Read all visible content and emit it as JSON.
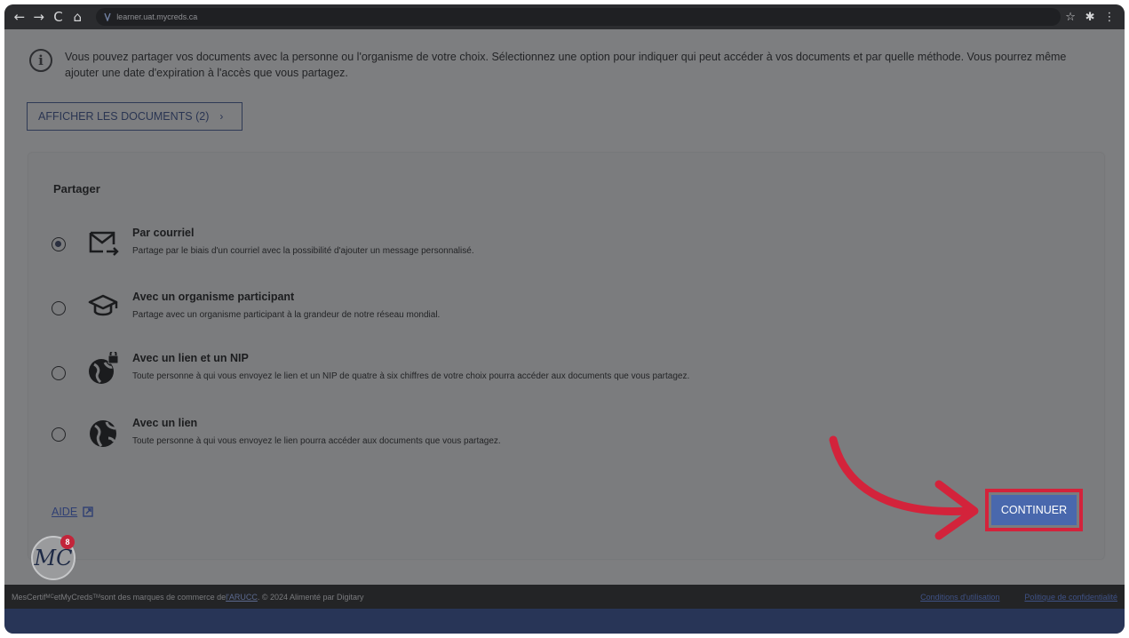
{
  "browser": {
    "url": "learner.uat.mycreds.ca",
    "back_glyph": "←",
    "forward_glyph": "→",
    "reload_glyph": "C",
    "home_glyph": "⌂",
    "star_glyph": "☆",
    "extension_glyph": "✱",
    "menu_glyph": "⋮"
  },
  "info": {
    "icon_glyph": "i",
    "text": "Vous pouvez partager vos documents avec la personne ou l'organisme de votre choix. Sélectionnez une option pour indiquer qui peut accéder à vos documents et par quelle méthode. Vous pourrez même ajouter une date d'expiration à l'accès que vous partagez."
  },
  "show_documents": {
    "label": "AFFICHER LES DOCUMENTS (2)",
    "chevron": "›"
  },
  "share": {
    "title": "Partager",
    "options": [
      {
        "title": "Par courriel",
        "description": "Partage par le biais d'un courriel avec la possibilité d'ajouter un message personnalisé.",
        "icon": "email-send-icon",
        "selected": true
      },
      {
        "title": "Avec un organisme participant",
        "description": "Partage avec un organisme participant à la grandeur de notre réseau mondial.",
        "icon": "graduation-cap-icon",
        "selected": false
      },
      {
        "title": "Avec un lien et un NIP",
        "description": "Toute personne à qui vous envoyez le lien et un NIP de quatre à six chiffres de votre choix pourra accéder aux documents que vous partagez.",
        "icon": "globe-lock-icon",
        "selected": false
      },
      {
        "title": "Avec un lien",
        "description": "Toute personne à qui vous envoyez le lien pourra accéder aux documents que vous partagez.",
        "icon": "globe-icon",
        "selected": false
      }
    ]
  },
  "help": {
    "label": "AIDE"
  },
  "continue": {
    "label": "CONTINUER"
  },
  "avatar": {
    "initials": "MC",
    "badge_count": "8"
  },
  "footer": {
    "brand_fr": "MesCertif",
    "brand_fr_mark": "MC",
    "connector": " et ",
    "brand_en": "MyCreds",
    "brand_en_mark": "TM",
    "text_a": " sont des marques de commerce de ",
    "org_link": "l'ARUCC",
    "text_b": ". © 2024 Alimenté par Digitary",
    "terms": "Conditions d'utilisation",
    "privacy": "Politique de confidentialité"
  },
  "colors": {
    "overlay_bg": "#7d7e80",
    "primary_button": "#4968ad",
    "highlight_red": "#d3233b",
    "footer_bg": "#232426",
    "bottom_band": "#283557"
  }
}
